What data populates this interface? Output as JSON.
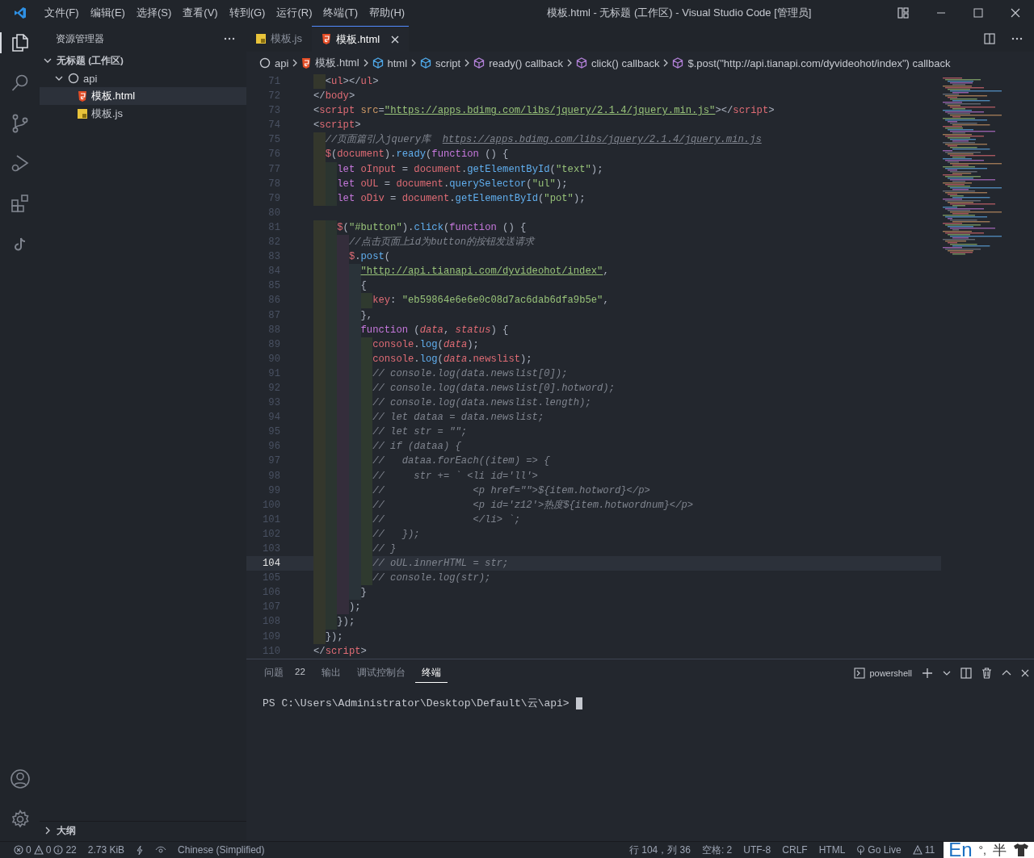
{
  "title_bar": {
    "menu": [
      "文件(F)",
      "编辑(E)",
      "选择(S)",
      "查看(V)",
      "转到(G)",
      "运行(R)",
      "终端(T)",
      "帮助(H)"
    ],
    "title": "模板.html - 无标题 (工作区) - Visual Studio Code [管理员]"
  },
  "activity_bar": {
    "items": [
      {
        "kind": "explorer",
        "selected": true
      },
      {
        "kind": "search",
        "selected": false
      },
      {
        "kind": "source-control",
        "selected": false
      },
      {
        "kind": "run",
        "selected": false
      },
      {
        "kind": "extensions",
        "selected": false
      },
      {
        "kind": "note",
        "selected": false
      }
    ]
  },
  "sidebar": {
    "title": "资源管理器",
    "workspace": {
      "label": "无标题 (工作区)",
      "expanded": true
    },
    "tree": [
      {
        "label": "api",
        "kind": "folder",
        "expanded": true,
        "selected": false,
        "children": [
          {
            "label": "模板.html",
            "kind": "html",
            "selected": true
          },
          {
            "label": "模板.js",
            "kind": "js",
            "selected": false
          }
        ]
      }
    ],
    "outline": {
      "label": "大纲",
      "expanded": false
    }
  },
  "tabs": [
    {
      "label": "模板.js",
      "kind": "js",
      "selected": false
    },
    {
      "label": "模板.html",
      "kind": "html",
      "selected": true
    }
  ],
  "breadcrumbs": [
    {
      "label": "api",
      "kind": "folder"
    },
    {
      "label": "模板.html",
      "kind": "html"
    },
    {
      "label": "html",
      "kind": "element"
    },
    {
      "label": "script",
      "kind": "element"
    },
    {
      "label": "ready() callback",
      "kind": "method"
    },
    {
      "label": "click() callback",
      "kind": "method"
    },
    {
      "label": "$.post(\"http://api.tianapi.com/dyvideohot/index\") callback",
      "kind": "method"
    }
  ],
  "editor": {
    "lines": [
      {
        "number": "71",
        "current": false,
        "tokens": [
          {
            "text": "  <",
            "kind": "punct"
          },
          {
            "text": "ul",
            "kind": "tag"
          },
          {
            "text": "></",
            "kind": "punct"
          },
          {
            "text": "ul",
            "kind": "tag"
          },
          {
            "text": ">",
            "kind": "punct"
          }
        ]
      },
      {
        "number": "72",
        "current": false,
        "tokens": [
          {
            "text": "</",
            "kind": "punct"
          },
          {
            "text": "body",
            "kind": "tag"
          },
          {
            "text": ">",
            "kind": "punct"
          }
        ]
      },
      {
        "number": "73",
        "current": false,
        "tokens": [
          {
            "text": "<",
            "kind": "punct"
          },
          {
            "text": "script",
            "kind": "tag"
          },
          {
            "text": " src",
            "kind": "attr"
          },
          {
            "text": "=",
            "kind": "punct"
          },
          {
            "text": "\"https://apps.bdimg.com/libs/jquery/2.1.4/jquery.min.js\"",
            "kind": "string-link"
          },
          {
            "text": "></",
            "kind": "punct"
          },
          {
            "text": "script",
            "kind": "tag"
          },
          {
            "text": ">",
            "kind": "punct"
          }
        ]
      },
      {
        "number": "74",
        "current": false,
        "tokens": [
          {
            "text": "<",
            "kind": "punct"
          },
          {
            "text": "script",
            "kind": "tag"
          },
          {
            "text": ">",
            "kind": "punct"
          }
        ]
      },
      {
        "number": "75",
        "current": false,
        "tokens": [
          {
            "text": "  //页面篇引入jquery库  ",
            "kind": "comment"
          },
          {
            "text": "https://apps.bdimg.com/libs/jquery/2.1.4/jquery.min.js",
            "kind": "comment-link"
          }
        ]
      },
      {
        "number": "76",
        "current": false,
        "tokens": [
          {
            "text": "  $",
            "kind": "var"
          },
          {
            "text": "(",
            "kind": "punct"
          },
          {
            "text": "document",
            "kind": "var"
          },
          {
            "text": ").",
            "kind": "punct"
          },
          {
            "text": "ready",
            "kind": "func"
          },
          {
            "text": "(",
            "kind": "punct"
          },
          {
            "text": "function",
            "kind": "keyword"
          },
          {
            "text": " () {",
            "kind": "punct"
          }
        ]
      },
      {
        "number": "77",
        "current": false,
        "tokens": [
          {
            "text": "    let ",
            "kind": "keyword"
          },
          {
            "text": "oInput",
            "kind": "var"
          },
          {
            "text": " = ",
            "kind": "punct"
          },
          {
            "text": "document",
            "kind": "var"
          },
          {
            "text": ".",
            "kind": "punct"
          },
          {
            "text": "getElementById",
            "kind": "func"
          },
          {
            "text": "(",
            "kind": "punct"
          },
          {
            "text": "\"text\"",
            "kind": "string"
          },
          {
            "text": ");",
            "kind": "punct"
          }
        ]
      },
      {
        "number": "78",
        "current": false,
        "tokens": [
          {
            "text": "    let ",
            "kind": "keyword"
          },
          {
            "text": "oUL",
            "kind": "var"
          },
          {
            "text": " = ",
            "kind": "punct"
          },
          {
            "text": "document",
            "kind": "var"
          },
          {
            "text": ".",
            "kind": "punct"
          },
          {
            "text": "querySelector",
            "kind": "func"
          },
          {
            "text": "(",
            "kind": "punct"
          },
          {
            "text": "\"ul\"",
            "kind": "string"
          },
          {
            "text": ");",
            "kind": "punct"
          }
        ]
      },
      {
        "number": "79",
        "current": false,
        "tokens": [
          {
            "text": "    let ",
            "kind": "keyword"
          },
          {
            "text": "oDiv",
            "kind": "var"
          },
          {
            "text": " = ",
            "kind": "punct"
          },
          {
            "text": "document",
            "kind": "var"
          },
          {
            "text": ".",
            "kind": "punct"
          },
          {
            "text": "getElementById",
            "kind": "func"
          },
          {
            "text": "(",
            "kind": "punct"
          },
          {
            "text": "\"pot\"",
            "kind": "string"
          },
          {
            "text": ");",
            "kind": "punct"
          }
        ]
      },
      {
        "number": "80",
        "current": false
      },
      {
        "number": "81",
        "current": false,
        "tokens": [
          {
            "text": "    $",
            "kind": "var"
          },
          {
            "text": "(",
            "kind": "punct"
          },
          {
            "text": "\"#button\"",
            "kind": "string"
          },
          {
            "text": ").",
            "kind": "punct"
          },
          {
            "text": "click",
            "kind": "func"
          },
          {
            "text": "(",
            "kind": "punct"
          },
          {
            "text": "function",
            "kind": "keyword"
          },
          {
            "text": " () {",
            "kind": "punct"
          }
        ]
      },
      {
        "number": "82",
        "current": false,
        "tokens": [
          {
            "text": "      //点击页面上id为button的按钮发送请求",
            "kind": "comment"
          }
        ]
      },
      {
        "number": "83",
        "current": false,
        "tokens": [
          {
            "text": "      $",
            "kind": "var"
          },
          {
            "text": ".",
            "kind": "punct"
          },
          {
            "text": "post",
            "kind": "func"
          },
          {
            "text": "(",
            "kind": "punct"
          }
        ]
      },
      {
        "number": "84",
        "current": false,
        "tokens": [
          {
            "text": "        \"http://api.tianapi.com/dyvideohot/index\"",
            "kind": "string-link"
          },
          {
            "text": ",",
            "kind": "punct"
          }
        ]
      },
      {
        "number": "85",
        "current": false,
        "tokens": [
          {
            "text": "        {",
            "kind": "punct"
          }
        ]
      },
      {
        "number": "86",
        "current": false,
        "tokens": [
          {
            "text": "          key",
            "kind": "var"
          },
          {
            "text": ": ",
            "kind": "punct"
          },
          {
            "text": "\"eb59864e6e6e0c08d7ac6dab6dfa9b5e\"",
            "kind": "string"
          },
          {
            "text": ",",
            "kind": "punct"
          }
        ]
      },
      {
        "number": "87",
        "current": false,
        "tokens": [
          {
            "text": "        },",
            "kind": "punct"
          }
        ]
      },
      {
        "number": "88",
        "current": false,
        "tokens": [
          {
            "text": "        function",
            "kind": "keyword"
          },
          {
            "text": " (",
            "kind": "punct"
          },
          {
            "text": "data",
            "kind": "param"
          },
          {
            "text": ", ",
            "kind": "punct"
          },
          {
            "text": "status",
            "kind": "param"
          },
          {
            "text": ") {",
            "kind": "punct"
          }
        ]
      },
      {
        "number": "89",
        "current": false,
        "tokens": [
          {
            "text": "          console",
            "kind": "var"
          },
          {
            "text": ".",
            "kind": "punct"
          },
          {
            "text": "log",
            "kind": "func"
          },
          {
            "text": "(",
            "kind": "punct"
          },
          {
            "text": "data",
            "kind": "param"
          },
          {
            "text": ");",
            "kind": "punct"
          }
        ]
      },
      {
        "number": "90",
        "current": false,
        "tokens": [
          {
            "text": "          console",
            "kind": "var"
          },
          {
            "text": ".",
            "kind": "punct"
          },
          {
            "text": "log",
            "kind": "func"
          },
          {
            "text": "(",
            "kind": "punct"
          },
          {
            "text": "data",
            "kind": "param"
          },
          {
            "text": ".",
            "kind": "punct"
          },
          {
            "text": "newslist",
            "kind": "var"
          },
          {
            "text": ");",
            "kind": "punct"
          }
        ]
      },
      {
        "number": "91",
        "current": false,
        "tokens": [
          {
            "text": "          // console.log(data.newslist[0]);",
            "kind": "comment"
          }
        ]
      },
      {
        "number": "92",
        "current": false,
        "tokens": [
          {
            "text": "          // console.log(data.newslist[0].hotword);",
            "kind": "comment"
          }
        ]
      },
      {
        "number": "93",
        "current": false,
        "tokens": [
          {
            "text": "          // console.log(data.newslist.length);",
            "kind": "comment"
          }
        ]
      },
      {
        "number": "94",
        "current": false,
        "tokens": [
          {
            "text": "          // let dataa = data.newslist;",
            "kind": "comment"
          }
        ]
      },
      {
        "number": "95",
        "current": false,
        "tokens": [
          {
            "text": "          // let str = \"\";",
            "kind": "comment"
          }
        ]
      },
      {
        "number": "96",
        "current": false,
        "tokens": [
          {
            "text": "          // if (dataa) {",
            "kind": "comment"
          }
        ]
      },
      {
        "number": "97",
        "current": false,
        "tokens": [
          {
            "text": "          //   dataa.forEach((item) => {",
            "kind": "comment"
          }
        ]
      },
      {
        "number": "98",
        "current": false,
        "tokens": [
          {
            "text": "          //     str += ` <li id='ll'>",
            "kind": "comment"
          }
        ]
      },
      {
        "number": "99",
        "current": false,
        "tokens": [
          {
            "text": "          //               <p href=\"\">${item.hotword}</p>",
            "kind": "comment"
          }
        ]
      },
      {
        "number": "100",
        "current": false,
        "tokens": [
          {
            "text": "          //               <p id='z12'>热度${item.hotwordnum}</p>",
            "kind": "comment"
          }
        ]
      },
      {
        "number": "101",
        "current": false,
        "tokens": [
          {
            "text": "          //               </li> `;",
            "kind": "comment"
          }
        ]
      },
      {
        "number": "102",
        "current": false,
        "tokens": [
          {
            "text": "          //   });",
            "kind": "comment"
          }
        ]
      },
      {
        "number": "103",
        "current": false,
        "tokens": [
          {
            "text": "          // }",
            "kind": "comment"
          }
        ]
      },
      {
        "number": "104",
        "current": true,
        "tokens": [
          {
            "text": "          // oUL.innerHTML = str;",
            "kind": "comment"
          }
        ]
      },
      {
        "number": "105",
        "current": false,
        "tokens": [
          {
            "text": "          // console.log(str);",
            "kind": "comment"
          }
        ]
      },
      {
        "number": "106",
        "current": false,
        "tokens": [
          {
            "text": "        }",
            "kind": "punct"
          }
        ]
      },
      {
        "number": "107",
        "current": false,
        "tokens": [
          {
            "text": "      );",
            "kind": "punct"
          }
        ]
      },
      {
        "number": "108",
        "current": false,
        "tokens": [
          {
            "text": "    });",
            "kind": "punct"
          }
        ]
      },
      {
        "number": "109",
        "current": false,
        "tokens": [
          {
            "text": "  });",
            "kind": "punct"
          }
        ]
      },
      {
        "number": "110",
        "current": false,
        "tokens": [
          {
            "text": "</",
            "kind": "punct"
          },
          {
            "text": "script",
            "kind": "tag"
          },
          {
            "text": ">",
            "kind": "punct"
          }
        ]
      }
    ]
  },
  "panel": {
    "tabs": [
      {
        "label": "问题",
        "badge": "22",
        "selected": false
      },
      {
        "label": "输出",
        "selected": false
      },
      {
        "label": "调试控制台",
        "selected": false
      },
      {
        "label": "终端",
        "selected": true
      }
    ],
    "terminal_name": "powershell",
    "prompt": "PS C:\\Users\\Administrator\\Desktop\\Default\\云\\api>"
  },
  "status_bar": {
    "errors": "0",
    "warnings": "0",
    "infos": "22",
    "file_size": "2.73 KiB",
    "language_pack": "Chinese (Simplified)",
    "position": "行 104，列 36",
    "indent": "空格: 2",
    "encoding": "UTF-8",
    "eol": "CRLF",
    "language": "HTML",
    "go_live": "Go Live",
    "alerts": "11"
  },
  "ime_bar": {
    "mode": "En",
    "punctuation": "°,",
    "width": "半"
  }
}
